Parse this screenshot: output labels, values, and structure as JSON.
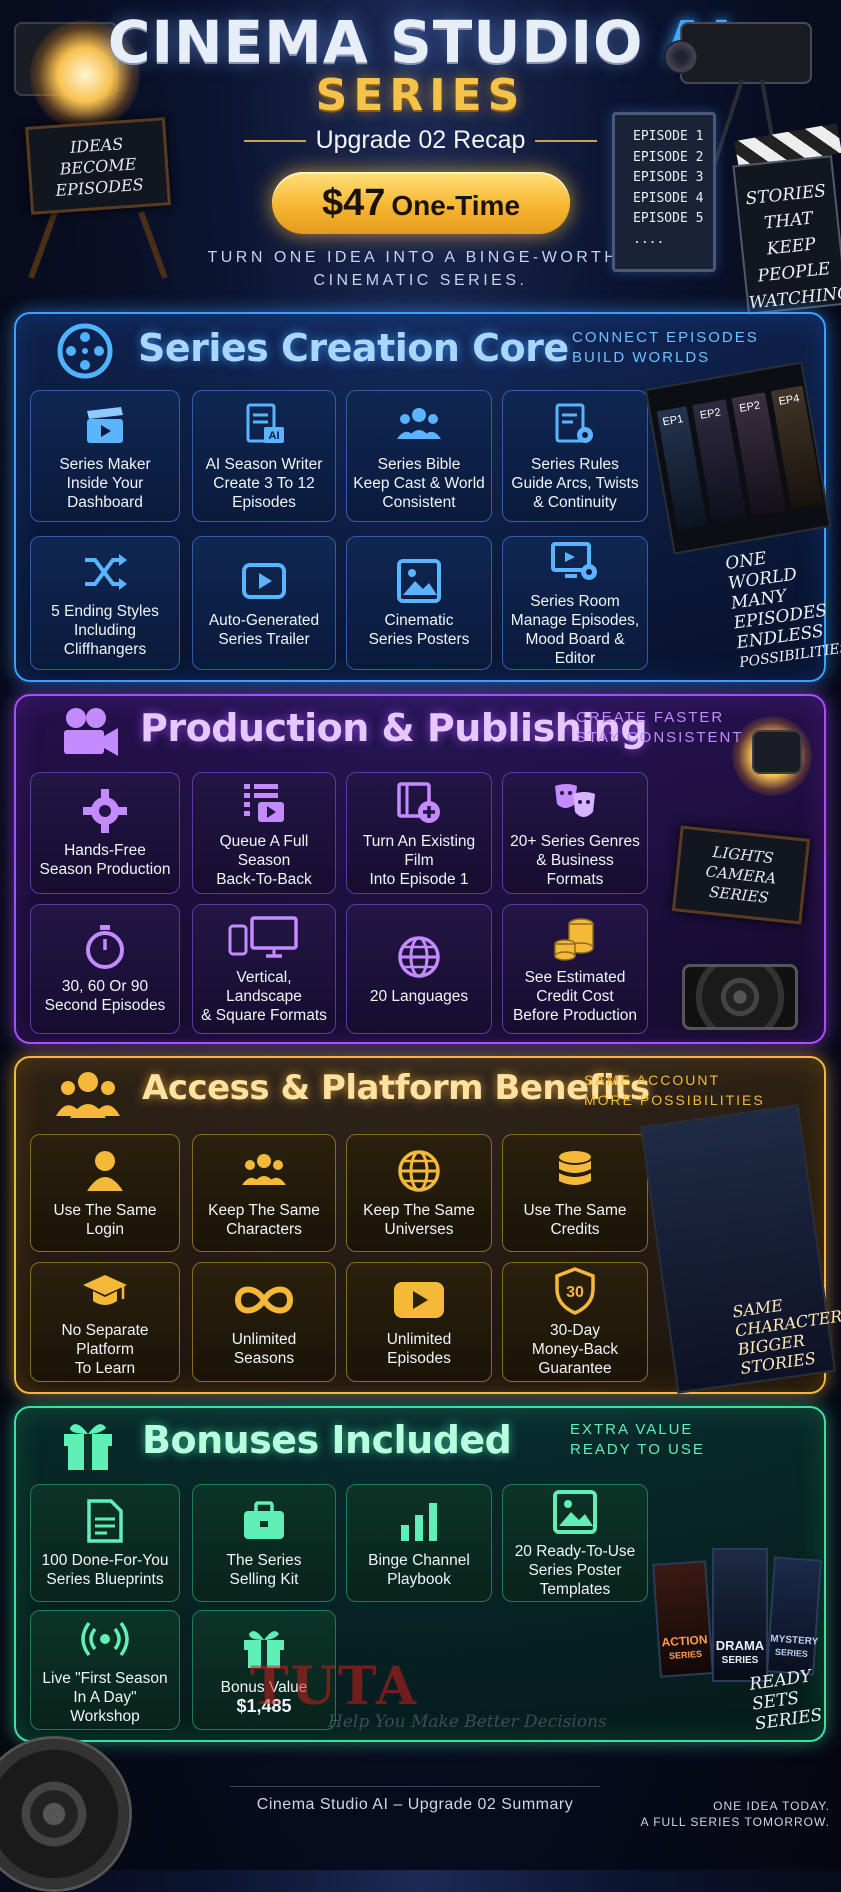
{
  "header": {
    "title_prefix": "CINEMA STUDIO ",
    "title_ai": "AI",
    "title_series": "SERIES",
    "subtitle": "Upgrade 02 Recap",
    "price_amount": "$47",
    "price_label": "One-Time",
    "tagline_1": "TURN ONE IDEA INTO A BINGE-WORTHY",
    "tagline_2": "CINEMATIC SERIES.",
    "chair_sign": [
      "IDEAS",
      "BECOME",
      "EPISODES"
    ],
    "episodes": [
      "EPISODE 1",
      "EPISODE 2",
      "EPISODE 3",
      "EPISODE 4",
      "EPISODE 5",
      "...."
    ],
    "clap_text": [
      "STORIES",
      "THAT",
      "KEEP",
      "PEOPLE",
      "WATCHING"
    ]
  },
  "sections": {
    "creation": {
      "title": "Series Creation Core",
      "side": [
        "CONNECT EPISODES",
        "BUILD WORLDS"
      ],
      "accent": "#3ca0ff",
      "tiles": [
        {
          "icon": "clapperboard-icon",
          "label": [
            "Series Maker",
            "Inside Your",
            "Dashboard"
          ]
        },
        {
          "icon": "ai-document-icon",
          "label": [
            "AI Season Writer",
            "Create 3 To 12",
            "Episodes"
          ]
        },
        {
          "icon": "group-icon",
          "label": [
            "Series Bible",
            "Keep Cast & World",
            "Consistent"
          ]
        },
        {
          "icon": "document-gear-icon",
          "label": [
            "Series Rules",
            "Guide Arcs, Twists",
            "& Continuity"
          ]
        },
        {
          "icon": "shuffle-icon",
          "label": [
            "5 Ending Styles",
            "Including",
            "Cliffhangers"
          ]
        },
        {
          "icon": "play-icon",
          "label": [
            "Auto-Generated",
            "Series Trailer"
          ]
        },
        {
          "icon": "image-icon",
          "label": [
            "Cinematic",
            "Series Posters"
          ]
        },
        {
          "icon": "monitor-gear-icon",
          "label": [
            "Series Room",
            "Manage Episodes,",
            "Mood Board & Editor"
          ]
        }
      ],
      "film_labels": [
        "EP1",
        "EP2",
        "EP2",
        "EP4"
      ],
      "film_caption": [
        "ONE",
        "WORLD",
        "MANY",
        "EPISODES",
        "ENDLESS",
        "POSSIBILITIES"
      ]
    },
    "production": {
      "title": "Production & Publishing",
      "side": [
        "CREATE FASTER",
        "STAY CONSISTENT"
      ],
      "accent": "#a94dff",
      "tiles": [
        {
          "icon": "gear-icon",
          "label": [
            "Hands-Free",
            "Season Production"
          ]
        },
        {
          "icon": "queue-icon",
          "label": [
            "Queue A Full Season",
            "Back-To-Back"
          ]
        },
        {
          "icon": "film-plus-icon",
          "label": [
            "Turn An Existing Film",
            "Into Episode 1"
          ]
        },
        {
          "icon": "theater-masks-icon",
          "label": [
            "20+ Series Genres",
            "& Business Formats"
          ]
        },
        {
          "icon": "stopwatch-icon",
          "label": [
            "30, 60 Or 90",
            "Second Episodes"
          ]
        },
        {
          "icon": "devices-icon",
          "label": [
            "Vertical, Landscape",
            "& Square Formats"
          ]
        },
        {
          "icon": "globe-icon",
          "label": [
            "20 Languages"
          ]
        },
        {
          "icon": "coins-icon",
          "label": [
            "See Estimated",
            "Credit Cost",
            "Before Production"
          ]
        }
      ],
      "chair_sign": [
        "LIGHTS",
        "CAMERA",
        "SERIES"
      ]
    },
    "access": {
      "title": "Access & Platform Benefits",
      "side": [
        "SAME ACCOUNT",
        "MORE POSSIBILITIES"
      ],
      "accent": "#f5b93a",
      "tiles": [
        {
          "icon": "user-icon",
          "label": [
            "Use The Same",
            "Login"
          ]
        },
        {
          "icon": "group-icon",
          "label": [
            "Keep The Same",
            "Characters"
          ]
        },
        {
          "icon": "globe-icon",
          "label": [
            "Keep The Same",
            "Universes"
          ]
        },
        {
          "icon": "database-icon",
          "label": [
            "Use The Same",
            "Credits"
          ]
        },
        {
          "icon": "graduation-cap-icon",
          "label": [
            "No Separate Platform",
            "To Learn"
          ]
        },
        {
          "icon": "infinity-icon",
          "label": [
            "Unlimited",
            "Seasons"
          ]
        },
        {
          "icon": "play-icon",
          "label": [
            "Unlimited",
            "Episodes"
          ]
        },
        {
          "icon": "shield-30-icon",
          "label": [
            "30-Day",
            "Money-Back",
            "Guarantee"
          ],
          "badge": "30"
        }
      ],
      "film_caption": [
        "SAME",
        "CHARACTERS",
        "BIGGER",
        "STORIES"
      ]
    },
    "bonuses": {
      "title": "Bonuses Included",
      "side": [
        "EXTRA VALUE",
        "READY TO USE"
      ],
      "accent": "#3ee0a0",
      "tiles": [
        {
          "icon": "document-icon",
          "label": [
            "100 Done-For-You",
            "Series Blueprints"
          ]
        },
        {
          "icon": "briefcase-icon",
          "label": [
            "The Series",
            "Selling Kit"
          ]
        },
        {
          "icon": "bar-chart-icon",
          "label": [
            "Binge Channel",
            "Playbook"
          ]
        },
        {
          "icon": "image-icon",
          "label": [
            "20 Ready-To-Use",
            "Series Poster",
            "Templates"
          ]
        },
        {
          "icon": "broadcast-icon",
          "label": [
            "Live \"First Season",
            "In A Day\"",
            "Workshop"
          ]
        },
        {
          "icon": "gift-icon",
          "label": [
            "Bonus Value",
            "$1,485"
          ]
        }
      ],
      "posters": [
        "ACTION",
        "SERIES",
        "DRAMA",
        "SERIES",
        "MYSTERY",
        "SERIES"
      ],
      "film_caption": [
        "READY",
        "SETS",
        "SERIES"
      ]
    }
  },
  "footer": {
    "center": "Cinema Studio AI – Upgrade 02 Summary",
    "right_1": "ONE IDEA TODAY.",
    "right_2": "A FULL SERIES TOMORROW."
  },
  "watermark": {
    "main": "TUTA",
    "sub": "Help You Make Better Decisions"
  }
}
